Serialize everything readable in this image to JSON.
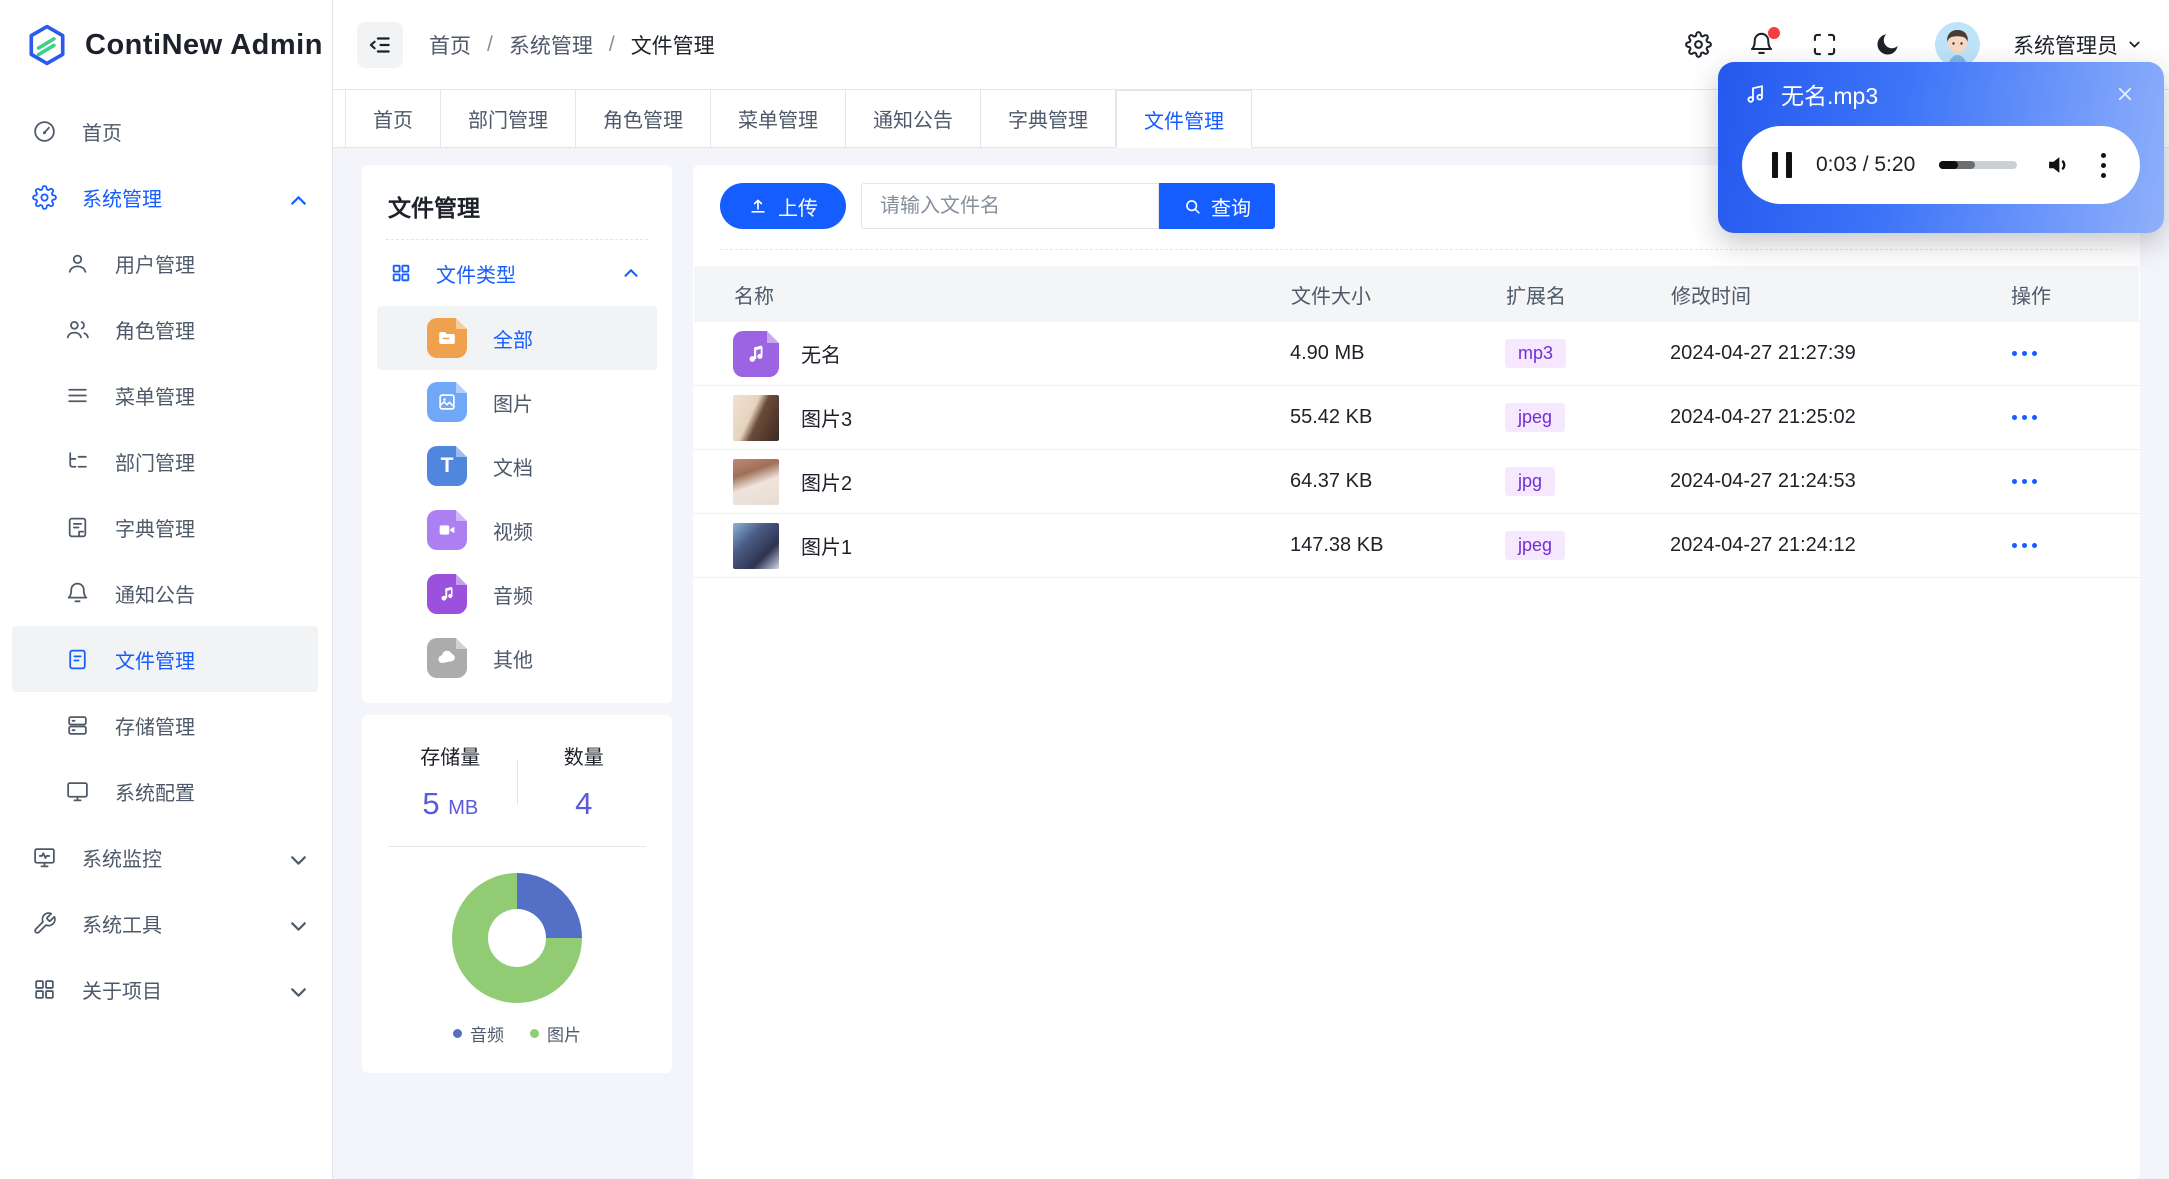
{
  "logo": {
    "title": "ContiNew Admin"
  },
  "header": {
    "breadcrumb": [
      "首页",
      "系统管理",
      "文件管理"
    ],
    "separator": "/",
    "user_name": "系统管理员"
  },
  "sidebar": {
    "items": [
      {
        "label": "首页",
        "icon": "dashboard-icon"
      },
      {
        "label": "系统管理",
        "icon": "gear-icon",
        "expanded": true,
        "children": [
          {
            "label": "用户管理",
            "icon": "user-icon"
          },
          {
            "label": "角色管理",
            "icon": "users-icon"
          },
          {
            "label": "菜单管理",
            "icon": "menu-icon"
          },
          {
            "label": "部门管理",
            "icon": "tree-icon"
          },
          {
            "label": "字典管理",
            "icon": "dictionary-icon"
          },
          {
            "label": "通知公告",
            "icon": "bell-icon"
          },
          {
            "label": "文件管理",
            "icon": "file-icon",
            "active": true
          },
          {
            "label": "存储管理",
            "icon": "storage-icon"
          },
          {
            "label": "系统配置",
            "icon": "monitor-icon"
          }
        ]
      },
      {
        "label": "系统监控",
        "icon": "monitor-pulse-icon",
        "collapsed": true
      },
      {
        "label": "系统工具",
        "icon": "wrench-icon",
        "collapsed": true
      },
      {
        "label": "关于项目",
        "icon": "grid-icon",
        "collapsed": true
      }
    ]
  },
  "tabs": {
    "items": [
      "首页",
      "部门管理",
      "角色管理",
      "菜单管理",
      "通知公告",
      "字典管理",
      "文件管理"
    ],
    "active": "文件管理"
  },
  "file_panel": {
    "title": "文件管理",
    "group_label": "文件类型",
    "types": [
      {
        "label": "全部",
        "icon": "folder-icon",
        "color": "#EFA14D",
        "active": true
      },
      {
        "label": "图片",
        "icon": "image-icon",
        "color": "#6FA8F8"
      },
      {
        "label": "文档",
        "icon": "document-icon",
        "color": "#5186DF"
      },
      {
        "label": "视频",
        "icon": "video-icon",
        "color": "#AC7FF2"
      },
      {
        "label": "音频",
        "icon": "music-icon",
        "color": "#9C51DE"
      },
      {
        "label": "其他",
        "icon": "cloud-icon",
        "color": "#ACACAC"
      }
    ],
    "stats": {
      "storage_label": "存储量",
      "storage_value": "5",
      "storage_unit": "MB",
      "count_label": "数量",
      "count_value": "4"
    }
  },
  "toolbar": {
    "upload_label": "上传",
    "search_placeholder": "请输入文件名",
    "query_label": "查询"
  },
  "table": {
    "columns": [
      "名称",
      "文件大小",
      "扩展名",
      "修改时间",
      "操作"
    ],
    "rows": [
      {
        "name": "无名",
        "size": "4.90 MB",
        "ext": "mp3",
        "time": "2024-04-27 21:27:39"
      },
      {
        "name": "图片3",
        "size": "55.42 KB",
        "ext": "jpeg",
        "time": "2024-04-27 21:25:02"
      },
      {
        "name": "图片2",
        "size": "64.37 KB",
        "ext": "jpg",
        "time": "2024-04-27 21:24:53"
      },
      {
        "name": "图片1",
        "size": "147.38 KB",
        "ext": "jpeg",
        "time": "2024-04-27 21:24:12"
      }
    ]
  },
  "audio_player": {
    "filename": "无名.mp3",
    "time_display": "0:03 / 5:20"
  },
  "chart_data": {
    "type": "pie",
    "subtype": "donut",
    "labels": [
      "音频",
      "图片"
    ],
    "values": [
      1,
      3
    ],
    "colors": [
      "#5470C6",
      "#91CC75"
    ],
    "legend_position": "bottom",
    "start_angle": "top",
    "direction": "clockwise"
  },
  "colors": {
    "primary": "#165DFF",
    "tag_text": "#722ED1",
    "tag_bg": "#F5E8FF",
    "stat_number": "#5A5BDC",
    "notification_dot": "#F53F3F",
    "audio_popup_gradient": [
      "#2558EE",
      "#8FB0FA"
    ]
  }
}
